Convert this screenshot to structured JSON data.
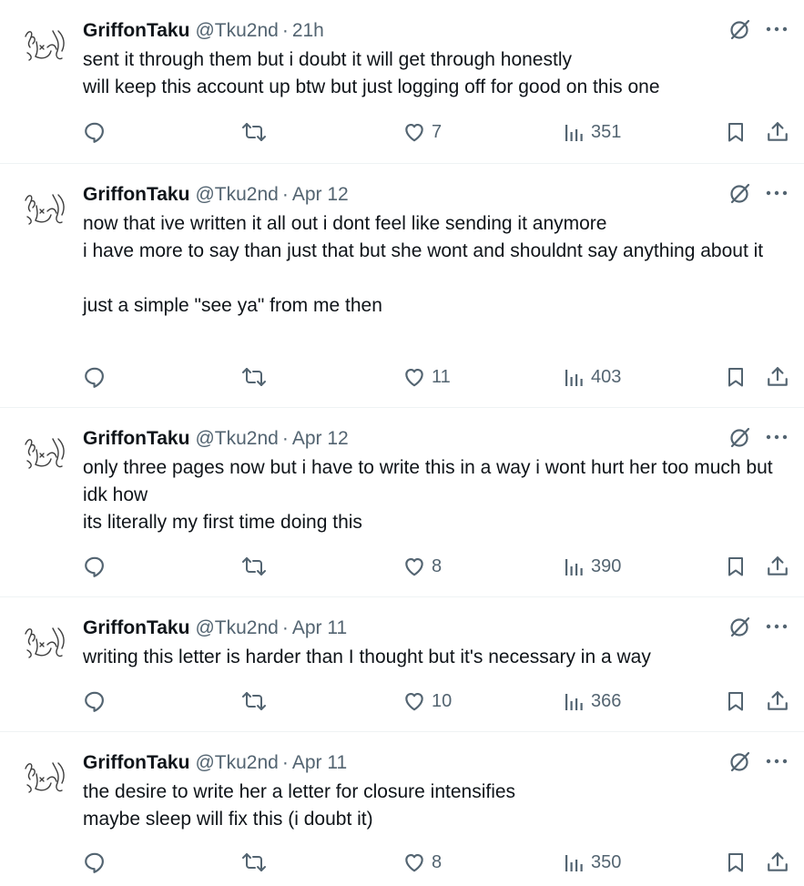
{
  "tweets": [
    {
      "name": "GriffonTaku",
      "handle": "@Tku2nd",
      "separator": "·",
      "time": "21h",
      "text": "sent it through them but i doubt it will get through honestly\nwill keep this account up btw but just logging off for good on this one",
      "likes": "7",
      "views": "351"
    },
    {
      "name": "GriffonTaku",
      "handle": "@Tku2nd",
      "separator": "·",
      "time": "Apr 12",
      "text": "now that ive written it all out i dont feel like sending it anymore\ni have more to say than just that but she wont and shouldnt say anything about it\n\njust a simple \"see ya\" from me then",
      "likes": "11",
      "views": "403"
    },
    {
      "name": "GriffonTaku",
      "handle": "@Tku2nd",
      "separator": "·",
      "time": "Apr 12",
      "text": "only three pages now but i have to write this in a way i wont hurt her too much but idk how\nits literally my first time doing this",
      "likes": "8",
      "views": "390"
    },
    {
      "name": "GriffonTaku",
      "handle": "@Tku2nd",
      "separator": "·",
      "time": "Apr 11",
      "text": "writing this letter is harder than I thought but it's necessary in a way",
      "likes": "10",
      "views": "366"
    },
    {
      "name": "GriffonTaku",
      "handle": "@Tku2nd",
      "separator": "·",
      "time": "Apr 11",
      "text": "the desire to write her a letter for closure intensifies\nmaybe sleep will fix this (i doubt it)",
      "likes": "8",
      "views": "350"
    }
  ],
  "icons": {
    "avatar": "sketch-avatar-icon",
    "grok": "grok-icon",
    "more": "more-options-icon",
    "reply": "reply-icon",
    "retweet": "retweet-icon",
    "like": "heart-icon",
    "views": "views-chart-icon",
    "bookmark": "bookmark-icon",
    "share": "share-icon"
  },
  "colors": {
    "text": "#0f1419",
    "secondary": "#536471",
    "divider": "#eff3f4"
  }
}
